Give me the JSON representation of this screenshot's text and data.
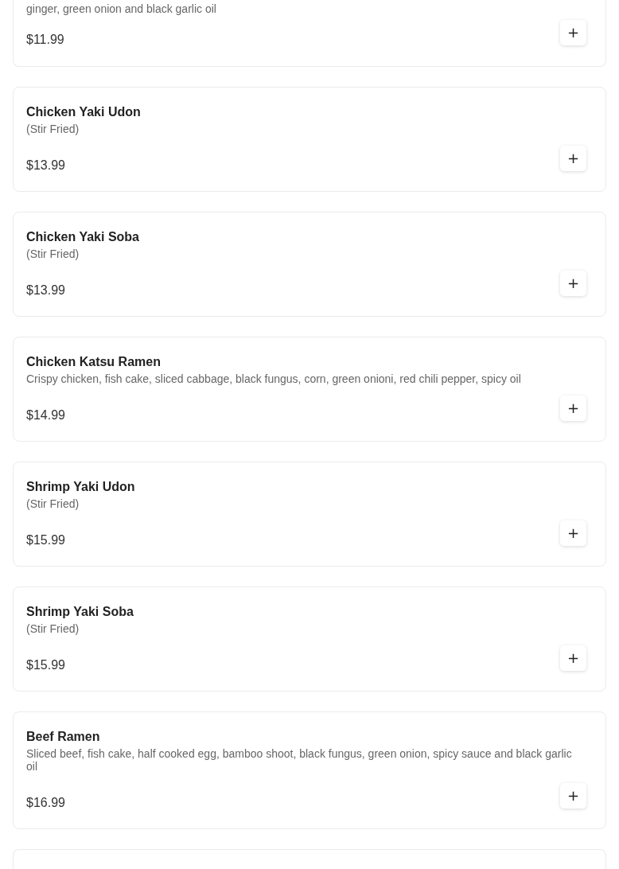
{
  "items": [
    {
      "description": "ginger, green onion and black garlic oil",
      "price": "$11.99",
      "add": "+"
    },
    {
      "name": "Chicken Yaki Udon",
      "description": "(Stir Fried)",
      "price": "$13.99",
      "add": "+"
    },
    {
      "name": "Chicken Yaki Soba",
      "description": "(Stir Fried)",
      "price": "$13.99",
      "add": "+"
    },
    {
      "name": "Chicken Katsu Ramen",
      "description": "Crispy chicken, fish cake, sliced cabbage, black fungus, corn, green onioni, red chili pepper, spicy oil",
      "price": "$14.99",
      "add": "+"
    },
    {
      "name": "Shrimp Yaki Udon",
      "description": "(Stir Fried)",
      "price": "$15.99",
      "add": "+"
    },
    {
      "name": "Shrimp Yaki Soba",
      "description": "(Stir Fried)",
      "price": "$15.99",
      "add": "+"
    },
    {
      "name": "Beef Ramen",
      "description": "Sliced beef, fish cake, half cooked egg, bamboo shoot, black fungus, green onion, spicy sauce and black garlic oil",
      "price": "$16.99",
      "add": "+"
    }
  ]
}
